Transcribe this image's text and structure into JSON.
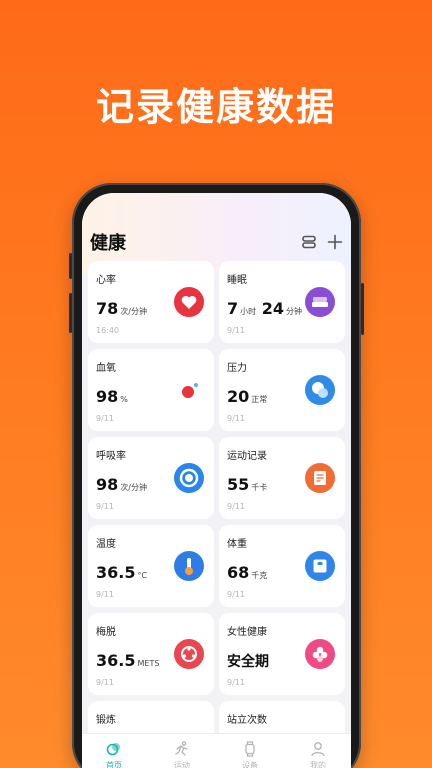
{
  "headline": "记录健康数据",
  "header": {
    "title": "健康"
  },
  "cards": [
    {
      "title": "心率",
      "value": "78",
      "unit": "次/分钟",
      "date": "16:40"
    },
    {
      "title": "睡眠",
      "value_a": "7",
      "unit_a": "小时",
      "value_b": "24",
      "unit_b": "分钟",
      "date": "9/11"
    },
    {
      "title": "血氧",
      "value": "98",
      "unit": "%",
      "date": "9/11"
    },
    {
      "title": "压力",
      "value": "20",
      "unit": "正常",
      "date": "9/11"
    },
    {
      "title": "呼吸率",
      "value": "98",
      "unit": "次/分钟",
      "date": "9/11"
    },
    {
      "title": "运动记录",
      "value": "55",
      "unit": "千卡",
      "date": "9/11"
    },
    {
      "title": "温度",
      "value": "36.5",
      "unit": "°C",
      "date": "9/11"
    },
    {
      "title": "体重",
      "value": "68",
      "unit": "千克",
      "date": "9/11"
    },
    {
      "title": "梅脱",
      "value": "36.5",
      "unit": "METS",
      "date": "9/11"
    },
    {
      "title": "女性健康",
      "value": "安全期",
      "unit": "",
      "date": "9/11"
    },
    {
      "title": "锻炼"
    },
    {
      "title": "站立次数"
    }
  ],
  "nav": [
    {
      "label": "首页",
      "icon": "home-icon",
      "active": true
    },
    {
      "label": "运动",
      "icon": "run-icon",
      "active": false
    },
    {
      "label": "设备",
      "icon": "watch-icon",
      "active": false
    },
    {
      "label": "我的",
      "icon": "user-icon",
      "active": false
    }
  ],
  "colors": {
    "background": "#ff6a18",
    "accent": "#19b7a8",
    "heart": "#e8343f",
    "sleep": "#8a4dd6",
    "stress": "#2f8ae8",
    "breath": "#2a86ea",
    "workout": "#f26a34",
    "temperature": "#2e7de6",
    "weight": "#2f86ea",
    "mets": "#e8474f",
    "female": "#ef4a86"
  }
}
